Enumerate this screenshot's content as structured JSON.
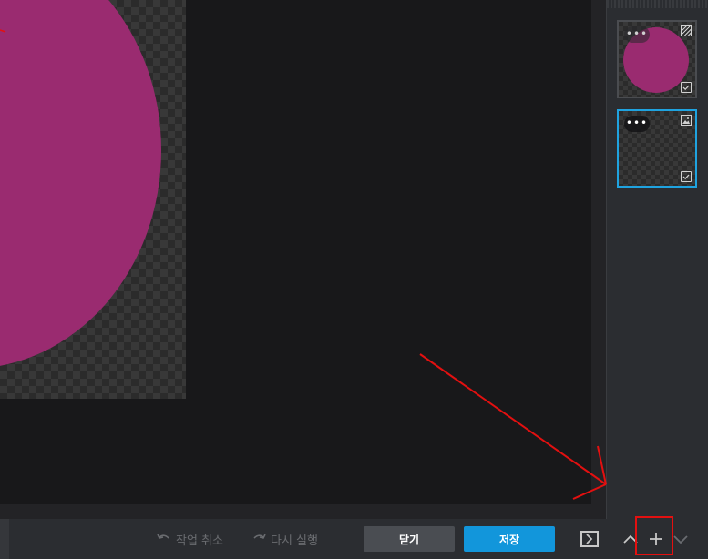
{
  "colors": {
    "circle_fill": "#9a2b70",
    "selected_border": "#1fa3e0",
    "save_button": "#1296db",
    "annotation": "#e31010"
  },
  "layers_panel": {
    "layers": [
      {
        "name": "shape-layer",
        "type_icon": "hatch-icon",
        "menu_label": "•••",
        "visible": true,
        "selected": false
      },
      {
        "name": "image-layer",
        "type_icon": "image-icon",
        "menu_label": "•••",
        "visible": true,
        "selected": true
      }
    ]
  },
  "toolbar": {
    "undo_label": "작업 취소",
    "redo_label": "다시 실행",
    "close_label": "닫기",
    "save_label": "저장",
    "undo_icon": "undo-arrow-icon",
    "redo_icon": "redo-arrow-icon",
    "panel_toggle_icon": "panel-toggle-icon",
    "move_up_icon": "chevron-up-icon",
    "add_icon": "plus-icon",
    "move_down_icon": "chevron-down-icon"
  }
}
